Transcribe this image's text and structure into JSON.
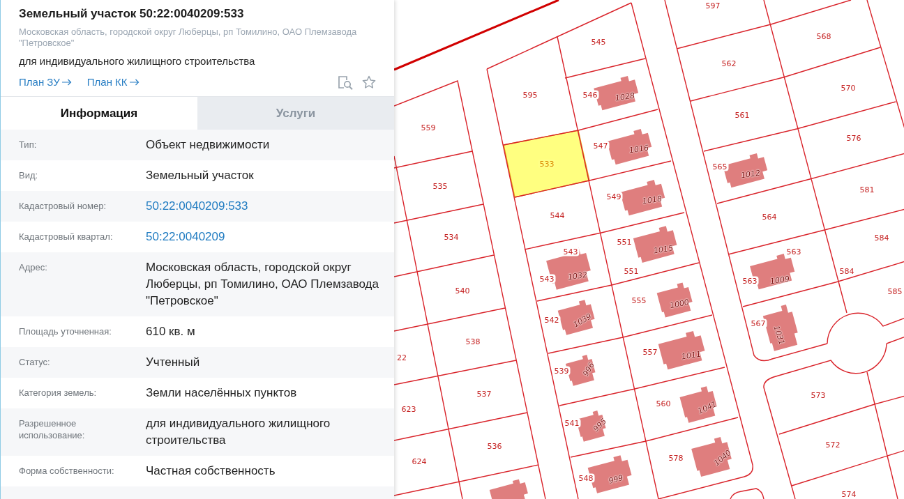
{
  "panel": {
    "title": "Земельный участок 50:22:0040209:533",
    "address": "Московская область, городской округ Люберцы, рп Томилино, ОАО Племзавода \"Петровское\"",
    "purpose": "для индивидуального жилищного строительства",
    "links": [
      {
        "label": "План ЗУ"
      },
      {
        "label": "План КК"
      }
    ]
  },
  "tabs": [
    {
      "label": "Информация",
      "selected": true
    },
    {
      "label": "Услуги",
      "selected": false
    }
  ],
  "rows": [
    {
      "label": "Тип:",
      "value": "Объект недвижимости",
      "kind": "text"
    },
    {
      "label": "Вид:",
      "value": "Земельный участок",
      "kind": "text"
    },
    {
      "label": "Кадастровый номер:",
      "value": "50:22:0040209:533",
      "kind": "link"
    },
    {
      "label": "Кадастровый квартал:",
      "value": "50:22:0040209",
      "kind": "link"
    },
    {
      "label": "Адрес:",
      "value": "Московская область, городской округ Люберцы, рп Томилино, ОАО Племзавода \"Петровское\"",
      "kind": "text"
    },
    {
      "label": "Площадь уточненная:",
      "value": "610 кв. м",
      "kind": "text"
    },
    {
      "label": "Статус:",
      "value": "Учтенный",
      "kind": "text"
    },
    {
      "label": "Категория земель:",
      "value": "Земли населённых пунктов",
      "kind": "text"
    },
    {
      "label": "Разрешенное использование:",
      "value": "для индивидуального жилищного строительства",
      "kind": "text"
    },
    {
      "label": "Форма собственности:",
      "value": "Частная собственность",
      "kind": "text"
    }
  ],
  "map": {
    "parcels": [
      {
        "number": "597",
        "selected": false
      },
      {
        "number": "568",
        "selected": false
      },
      {
        "number": "545",
        "selected": false
      },
      {
        "number": "562",
        "selected": false
      },
      {
        "number": "570",
        "selected": false
      },
      {
        "number": "595",
        "selected": false
      },
      {
        "number": "546",
        "selected": false
      },
      {
        "number": "561",
        "selected": false
      },
      {
        "number": "559",
        "selected": false
      },
      {
        "number": "576",
        "selected": false
      },
      {
        "number": "547",
        "selected": false
      },
      {
        "number": "533",
        "selected": true
      },
      {
        "number": "565",
        "selected": false
      },
      {
        "number": "535",
        "selected": false
      },
      {
        "number": "581",
        "selected": false
      },
      {
        "number": "549",
        "selected": false
      },
      {
        "number": "544",
        "selected": false
      },
      {
        "number": "564",
        "selected": false
      },
      {
        "number": "534",
        "selected": false
      },
      {
        "number": "584",
        "selected": false
      },
      {
        "number": "551",
        "selected": false
      },
      {
        "number": "543",
        "selected": false
      },
      {
        "number": "563",
        "selected": false
      },
      {
        "number": "584",
        "selected": false
      },
      {
        "number": "551",
        "selected": false
      },
      {
        "number": "543",
        "selected": false
      },
      {
        "number": "563",
        "selected": false
      },
      {
        "number": "540",
        "selected": false
      },
      {
        "number": "585",
        "selected": false
      },
      {
        "number": "555",
        "selected": false
      },
      {
        "number": "542",
        "selected": false
      },
      {
        "number": "567",
        "selected": false
      },
      {
        "number": "538",
        "selected": false
      },
      {
        "number": "557",
        "selected": false
      },
      {
        "number": "22",
        "selected": false
      },
      {
        "number": "539",
        "selected": false
      },
      {
        "number": "537",
        "selected": false
      },
      {
        "number": "573",
        "selected": false
      },
      {
        "number": "560",
        "selected": false
      },
      {
        "number": "623",
        "selected": false
      },
      {
        "number": "541",
        "selected": false
      },
      {
        "number": "572",
        "selected": false
      },
      {
        "number": "536",
        "selected": false
      },
      {
        "number": "578",
        "selected": false
      },
      {
        "number": "624",
        "selected": false
      },
      {
        "number": "548",
        "selected": false
      },
      {
        "number": "574",
        "selected": false
      }
    ],
    "buildings": [
      {
        "number": "1028"
      },
      {
        "number": "1016"
      },
      {
        "number": "1012"
      },
      {
        "number": "1018"
      },
      {
        "number": "1015"
      },
      {
        "number": "1032"
      },
      {
        "number": "1009"
      },
      {
        "number": "1000"
      },
      {
        "number": "1039"
      },
      {
        "number": "1031"
      },
      {
        "number": "1011"
      },
      {
        "number": "996"
      },
      {
        "number": "1041"
      },
      {
        "number": "995"
      },
      {
        "number": "1040"
      },
      {
        "number": "999"
      }
    ]
  }
}
